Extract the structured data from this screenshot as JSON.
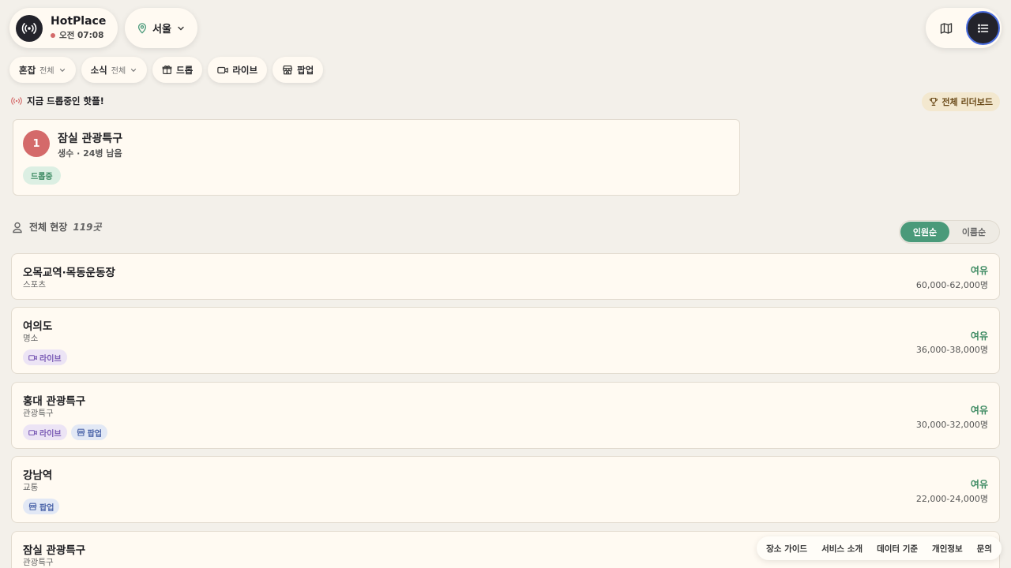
{
  "brand": {
    "title": "HotPlace",
    "time": "오전 07:08"
  },
  "city": {
    "label": "서울"
  },
  "filters": {
    "crowd": {
      "label": "혼잡",
      "value": "전체"
    },
    "news": {
      "label": "소식",
      "value": "전체"
    },
    "drop": {
      "label": "드롭"
    },
    "live": {
      "label": "라이브"
    },
    "popup": {
      "label": "팝업"
    }
  },
  "drop_section": {
    "title": "지금 드롭중인 핫플!",
    "leaderboard_label": "전체 리더보드",
    "item": {
      "rank": "1",
      "name": "잠실 관광특구",
      "sub": "생수 · 24병 남음",
      "tag": "드롭중"
    }
  },
  "all_section": {
    "title": "전체 현장",
    "count": "119곳",
    "sort": {
      "active": "인원순",
      "other": "이름순"
    }
  },
  "places": [
    {
      "name": "오목교역·목동운동장",
      "category": "스포츠",
      "status": "여유",
      "range": "60,000-62,000명"
    },
    {
      "name": "여의도",
      "category": "명소",
      "live": "라이브",
      "status": "여유",
      "range": "36,000-38,000명"
    },
    {
      "name": "홍대 관광특구",
      "category": "관광특구",
      "live": "라이브",
      "popup": "팝업",
      "status": "여유",
      "range": "30,000-32,000명"
    },
    {
      "name": "강남역",
      "category": "교통",
      "popup": "팝업",
      "status": "여유",
      "range": "22,000-24,000명"
    },
    {
      "name": "잠실 관광특구",
      "category": "관광특구"
    }
  ],
  "footer": {
    "guide": "장소 가이드",
    "about": "서비스 소개",
    "data": "데이터 기준",
    "privacy": "개인정보",
    "contact": "문의"
  },
  "colors": {
    "accent_green": "#4a9a7a",
    "drop_red": "#d46a6a",
    "dark": "#23232b"
  }
}
